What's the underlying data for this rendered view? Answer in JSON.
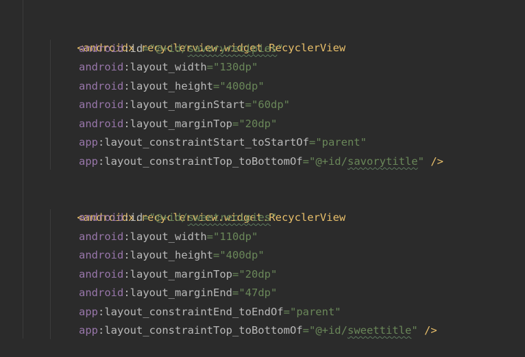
{
  "blocks": [
    {
      "open_tag": "<androidx.recyclerview.widget.RecyclerView",
      "attrs": [
        {
          "ns": "android",
          "name": "id",
          "value_pre": "\"@+id/",
          "value_link": "savoryrecipies",
          "value_post": "\""
        },
        {
          "ns": "android",
          "name": "layout_width",
          "value": "\"130dp\""
        },
        {
          "ns": "android",
          "name": "layout_height",
          "value": "\"400dp\""
        },
        {
          "ns": "android",
          "name": "layout_marginStart",
          "value": "\"60dp\""
        },
        {
          "ns": "android",
          "name": "layout_marginTop",
          "value": "\"20dp\""
        },
        {
          "ns": "app",
          "name": "layout_constraintStart_toStartOf",
          "value": "\"parent\""
        },
        {
          "ns": "app",
          "name": "layout_constraintTop_toBottomOf",
          "value_pre": "\"@+id/",
          "value_link": "savorytitle",
          "value_post": "\"",
          "close": " />"
        }
      ]
    },
    {
      "open_tag": "<androidx.recyclerview.widget.RecyclerView",
      "attrs": [
        {
          "ns": "android",
          "name": "id",
          "value_pre": "\"@+id/",
          "value_link": "sweetrecipies",
          "value_post": "\""
        },
        {
          "ns": "android",
          "name": "layout_width",
          "value": "\"110dp\""
        },
        {
          "ns": "android",
          "name": "layout_height",
          "value": "\"400dp\""
        },
        {
          "ns": "android",
          "name": "layout_marginTop",
          "value": "\"20dp\""
        },
        {
          "ns": "android",
          "name": "layout_marginEnd",
          "value": "\"47dp\""
        },
        {
          "ns": "app",
          "name": "layout_constraintEnd_toEndOf",
          "value": "\"parent\""
        },
        {
          "ns": "app",
          "name": "layout_constraintTop_toBottomOf",
          "value_pre": "\"@+id/",
          "value_link": "sweettitle",
          "value_post": "\"",
          "close": " />"
        }
      ]
    }
  ],
  "punct": {
    "colon": ":",
    "equals": "="
  },
  "colors": {
    "background": "#2b2b2b",
    "tag": "#e8bf6a",
    "namespace": "#9876aa",
    "attribute": "#bababa",
    "string": "#6a8759"
  }
}
